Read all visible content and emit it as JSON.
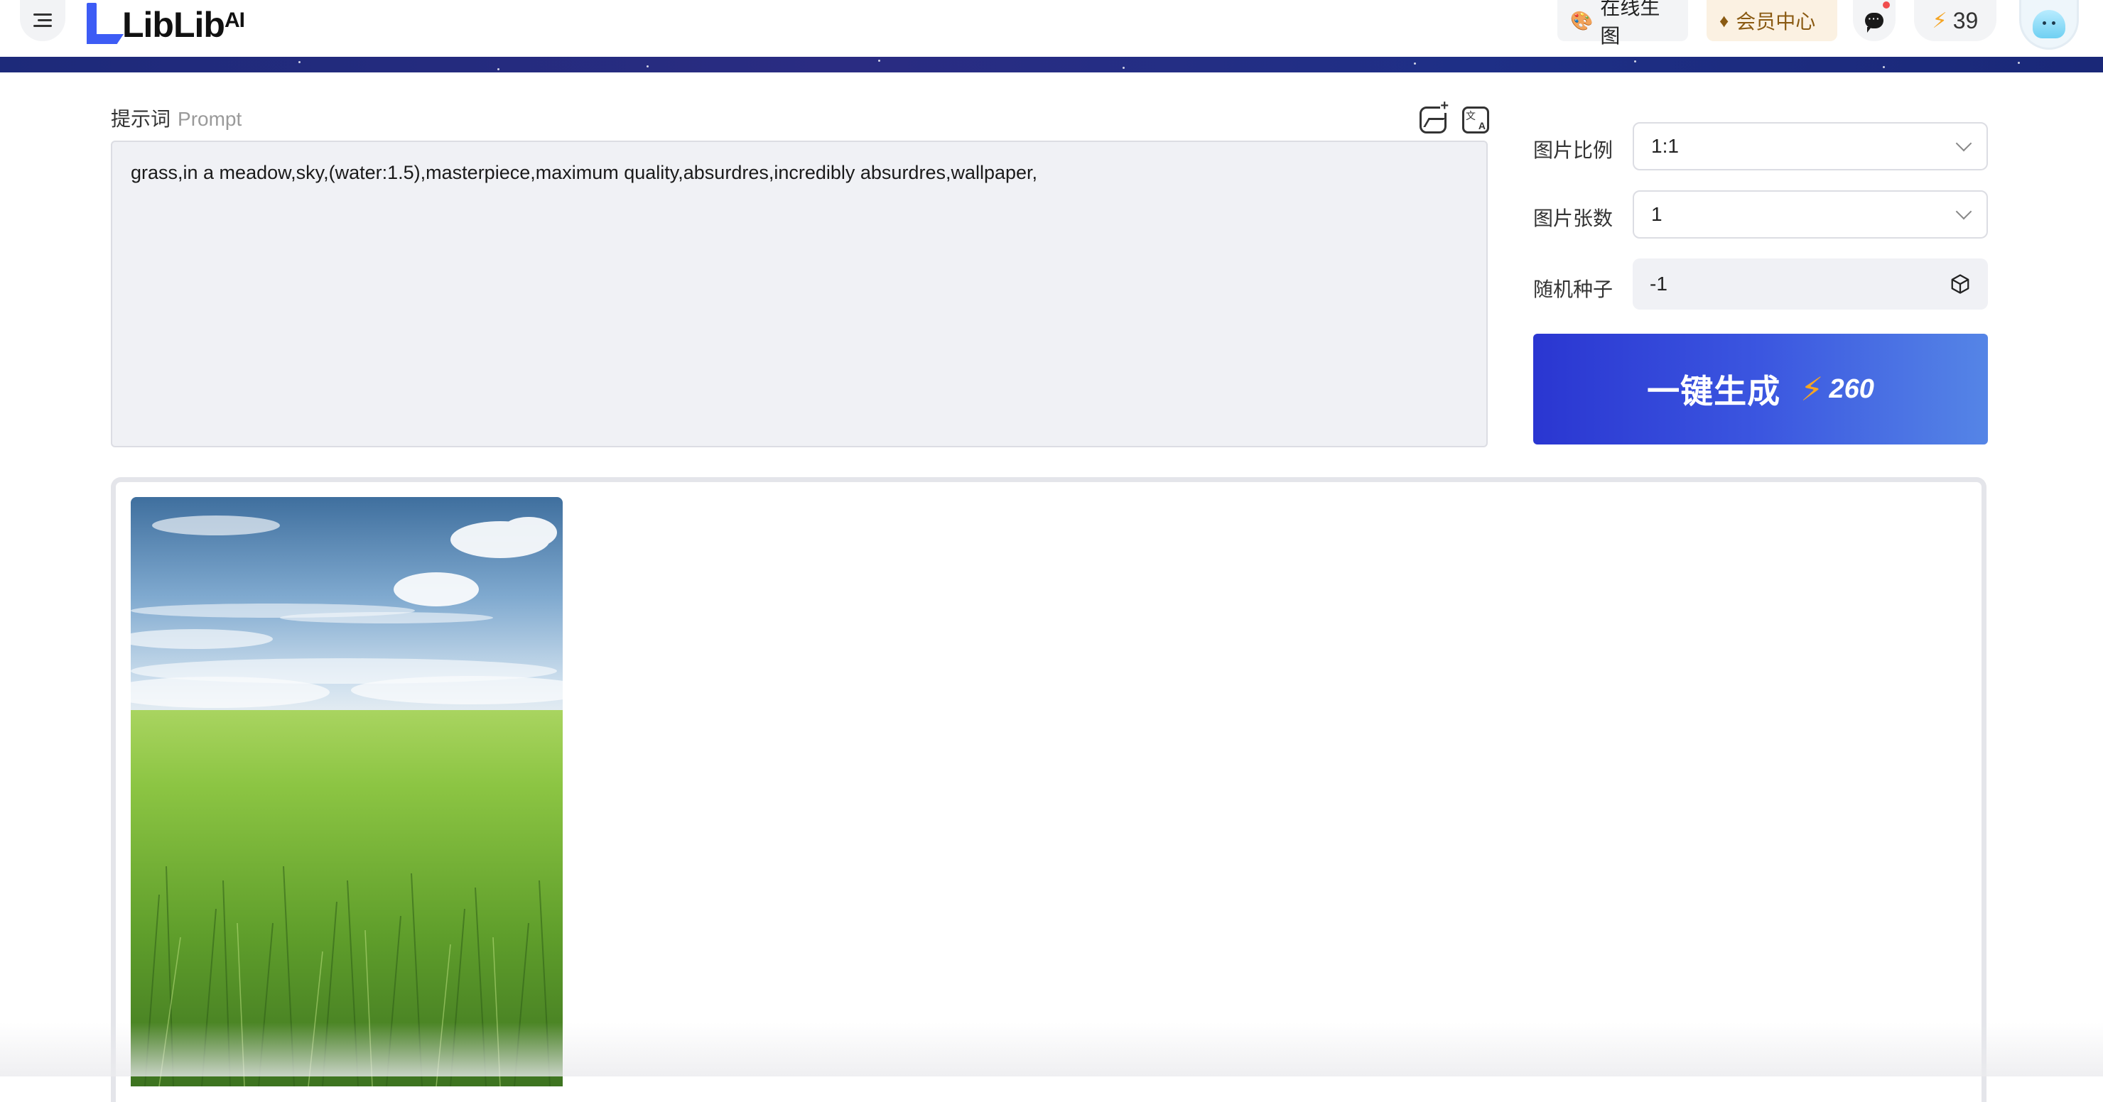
{
  "header": {
    "logo_text": "LibLib",
    "logo_suffix": "AI",
    "online_label": "在线生图",
    "vip_label": "会员中心",
    "credits": "39"
  },
  "prompt": {
    "label": "提示词",
    "label_en": "Prompt",
    "value": "grass,in a meadow,sky,(water:1.5),masterpiece,maximum quality,absurdres,incredibly absurdres,wallpaper,"
  },
  "settings": {
    "ratio_label": "图片比例",
    "ratio_value": "1:1",
    "count_label": "图片张数",
    "count_value": "1",
    "seed_label": "随机种子",
    "seed_value": "-1"
  },
  "generate": {
    "label": "一键生成",
    "cost": "260"
  },
  "icons": {
    "menu": "hamburger-icon",
    "palette": "palette-icon",
    "diamond": "diamond-icon",
    "message": "message-icon",
    "bolt": "bolt-icon",
    "dice": "dice-icon"
  },
  "colors": {
    "brand": "#3d5cf5",
    "generate_start": "#2a36d1",
    "generate_end": "#5585e6",
    "bolt": "#f5a524"
  }
}
